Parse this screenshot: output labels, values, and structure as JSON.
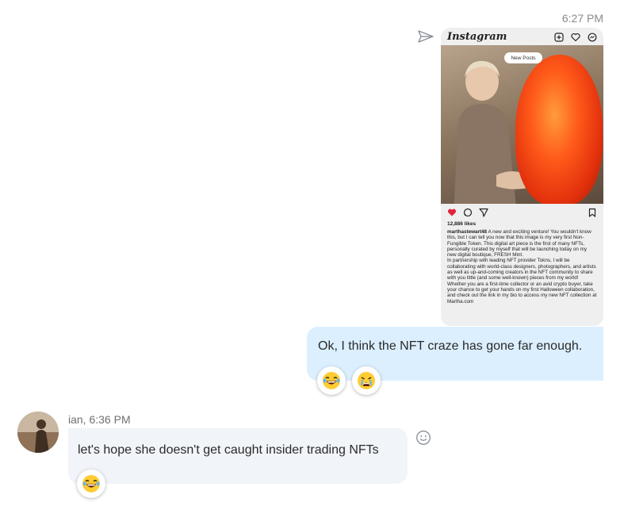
{
  "outgoing": {
    "timestamp": "6:27 PM",
    "message_text": "Ok, I think the NFT craze has gone far enough.",
    "reactions": [
      "laughing-emoji",
      "crying-emoji"
    ],
    "attachment": {
      "app_name": "Instagram",
      "banner": "New Posts",
      "likes": "12,886 likes",
      "username": "marthastewart48",
      "caption_1": " A new and exciting venture! You wouldn't know this, but I can tell you now that this image is my very first Non-Fungible Token. This digital art piece is the first of many NFTs, personally curated by myself that will be launching today on my new digital boutique, FRESH Mint.",
      "caption_2": "In partnership with leading NFT provider Tokns, I will be collaborating with world-class designers, photographers, and artists as well as up-and-coming creators in the NFT community to share with you little (and some well-known) pieces from my world! Whether you are a first-time collector or an avid crypto buyer, take your chance to get your hands on my first Halloween collaboration, and check out the link in my bio to access my new NFT collection at Martha.com"
    }
  },
  "incoming": {
    "sender_line": "ian, 6:36 PM",
    "message_text": "let's hope she doesn't get caught insider trading NFTs",
    "reactions": [
      "laughing-emoji"
    ]
  },
  "icons": {
    "send": "send-icon",
    "add_reaction": "smiley-icon"
  }
}
